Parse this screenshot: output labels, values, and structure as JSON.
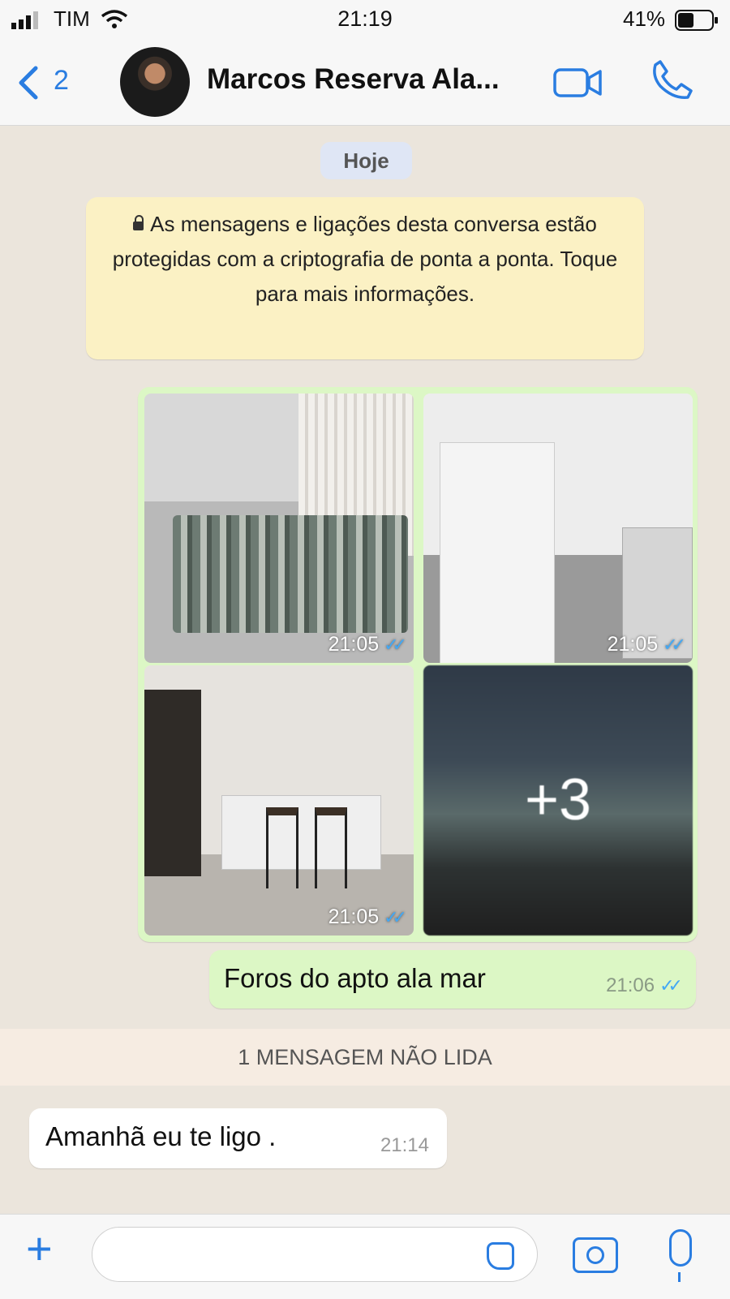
{
  "status_bar": {
    "carrier": "TIM",
    "time": "21:19",
    "battery": "41%"
  },
  "header": {
    "back_count": "2",
    "contact_name": "Marcos Reserva Ala...",
    "icons": [
      "video-call-icon",
      "voice-call-icon"
    ]
  },
  "chat": {
    "date_pill": "Hoje",
    "encryption_notice": "As mensagens e ligações desta conversa estão protegidas com a criptografia de ponta a ponta. Toque para mais informações.",
    "photo_group": {
      "photos": [
        {
          "time": "21:05",
          "status": "read"
        },
        {
          "time": "21:05",
          "status": "read"
        },
        {
          "time": "21:05",
          "status": "read"
        },
        {
          "more_count": "+3"
        }
      ]
    },
    "outgoing_message": {
      "text": "Foros do apto ala mar",
      "time": "21:06",
      "status": "read"
    },
    "unread_banner": "1 MENSAGEM NÃO LIDA",
    "incoming_message": {
      "text": "Amanhã eu te ligo .",
      "time": "21:14"
    }
  },
  "input_bar": {
    "icons": [
      "plus-icon",
      "sticker-icon",
      "camera-icon",
      "microphone-icon"
    ]
  },
  "colors": {
    "accent": "#2a7de1",
    "outgoing_bubble": "#dcf7c5",
    "notice_bg": "#fbf1c4",
    "read_ticks": "#43a8f4"
  }
}
